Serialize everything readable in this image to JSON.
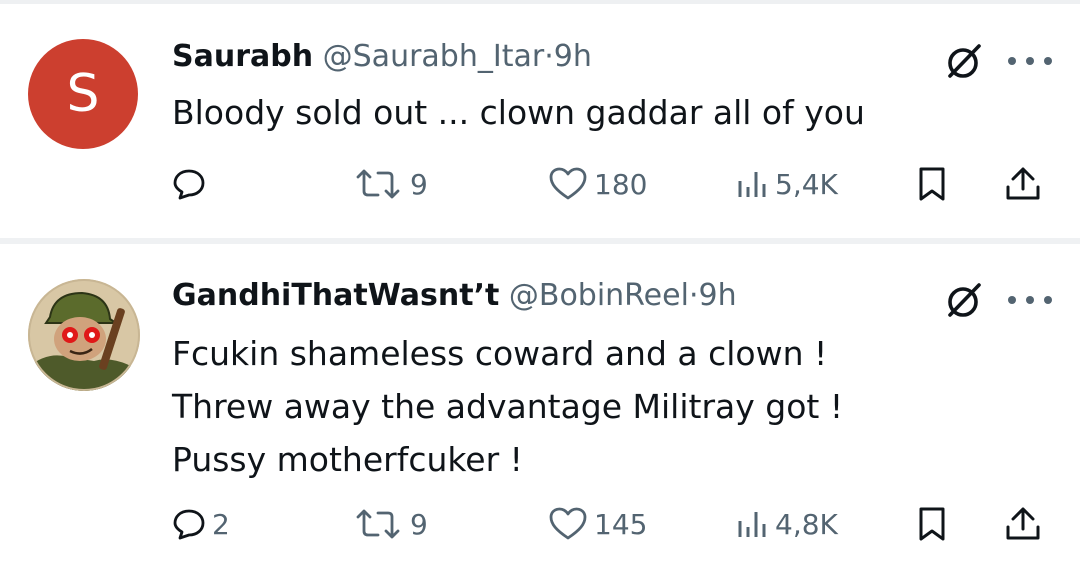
{
  "tweets": [
    {
      "avatar_initial": "S",
      "avatar_color": "#cc3f2f",
      "name": "Saurabh",
      "handle": "@Saurabh_Itar",
      "separator": "·",
      "time": "9h",
      "text_lines": [
        "Bloody sold out ... clown gaddar all of you"
      ],
      "reply_count": "",
      "retweet_count": "9",
      "like_count": "180",
      "view_count": "5,4K"
    },
    {
      "avatar_icon": "soldier-cartoon-avatar",
      "name": "GandhiThatWasnt’t",
      "handle": "@BobinReel",
      "separator": "·",
      "time": "9h",
      "text_lines": [
        "Fcukin shameless coward and a clown !",
        "Threw away the advantage Militray got !",
        "Pussy motherfcuker !"
      ],
      "reply_count": "2",
      "retweet_count": "9",
      "like_count": "145",
      "view_count": "4,8K"
    }
  ],
  "icons": {
    "reply": "reply-icon",
    "retweet": "retweet-icon",
    "like": "heart-icon",
    "views": "views-icon",
    "bookmark": "bookmark-icon",
    "share": "share-icon",
    "grok": "grok-icon",
    "more": "more-icon"
  },
  "colors": {
    "text": "#0f1419",
    "muted": "#536471",
    "divider": "#eff1f3"
  }
}
